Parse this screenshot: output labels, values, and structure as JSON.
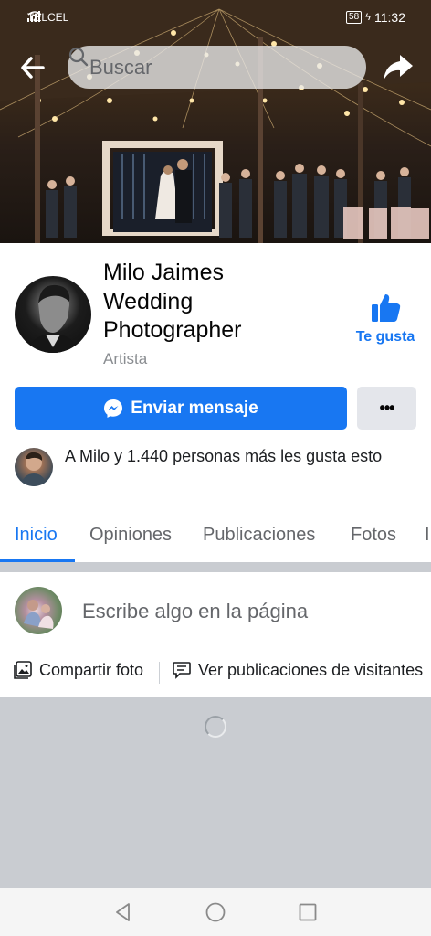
{
  "status_bar": {
    "carrier": "TELCEL",
    "battery": "58",
    "time": "11:32"
  },
  "header": {
    "search_placeholder": "Buscar"
  },
  "page": {
    "name_line1": "Milo Jaimes",
    "name_line2": "Wedding",
    "name_line3": "Photographer",
    "category": "Artista",
    "like_label": "Te gusta",
    "message_button": "Enviar mensaje",
    "more_button": "•••",
    "friends_likes": "A Milo y 1.440 personas más les gusta esto"
  },
  "tabs": [
    {
      "label": "Inicio",
      "active": true
    },
    {
      "label": "Opiniones",
      "active": false
    },
    {
      "label": "Publicaciones",
      "active": false
    },
    {
      "label": "Fotos",
      "active": false
    }
  ],
  "composer": {
    "placeholder": "Escribe algo en la página",
    "share_photo": "Compartir foto",
    "visitor_posts": "Ver publicaciones de visitantes"
  },
  "colors": {
    "accent": "#1877f2",
    "surface": "#ffffff",
    "background": "#c9ccd1"
  },
  "icons": [
    "back-arrow-icon",
    "search-icon",
    "share-icon",
    "thumbs-up-icon",
    "messenger-icon",
    "photo-icon",
    "comment-icon"
  ]
}
